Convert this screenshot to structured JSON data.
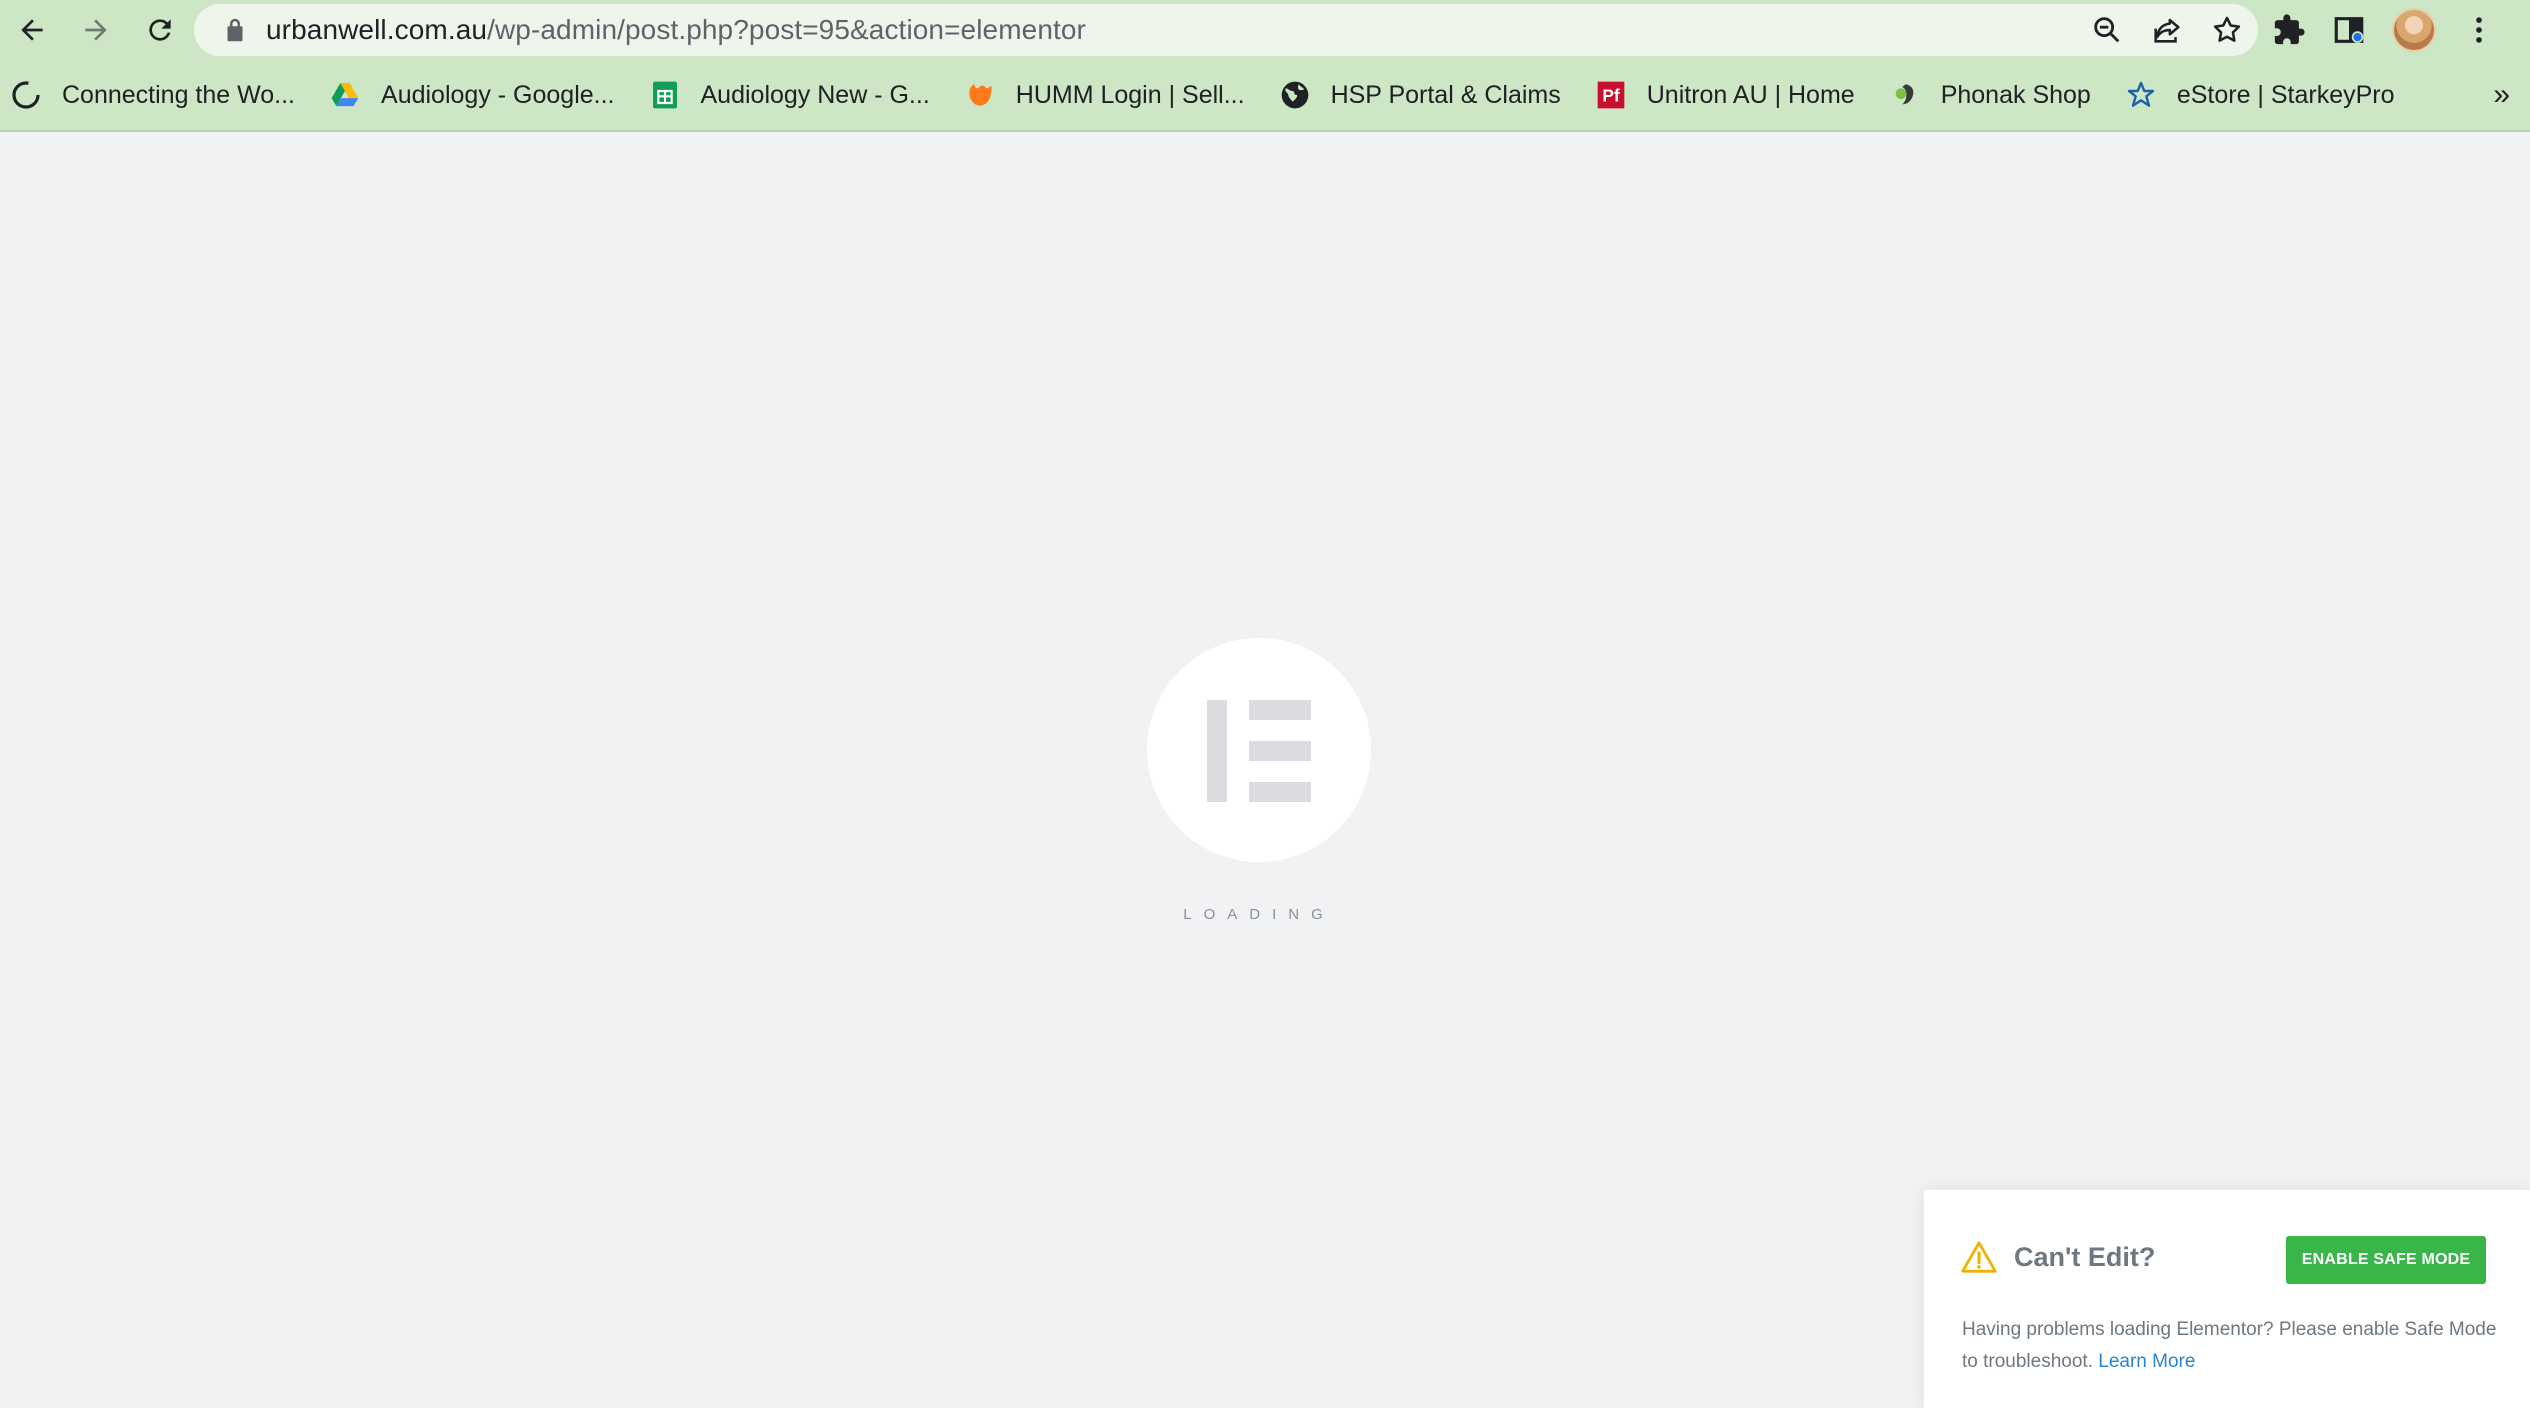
{
  "browser": {
    "url_host": "urbanwell.com.au",
    "url_path": "/wp-admin/post.php?post=95&action=elementor",
    "icons": {
      "back": "back-arrow-icon",
      "forward": "forward-arrow-icon",
      "reload": "reload-icon",
      "lock": "lock-icon",
      "zoom": "zoom-icon",
      "share": "share-icon",
      "bookmark": "star-icon",
      "extensions": "puzzle-icon",
      "sidepanel": "side-panel-icon",
      "menu": "kebab-menu-icon"
    },
    "bookmarks": [
      {
        "label": "Connecting the Wo...",
        "icon": "loading-circle-icon"
      },
      {
        "label": "Audiology - Google...",
        "icon": "google-drive-icon"
      },
      {
        "label": "Audiology New - G...",
        "icon": "google-sheets-icon"
      },
      {
        "label": "HUMM Login | Sell...",
        "icon": "humm-icon"
      },
      {
        "label": "HSP Portal & Claims",
        "icon": "globe-icon"
      },
      {
        "label": "Unitron AU | Home",
        "icon": "unitron-icon"
      },
      {
        "label": "Phonak Shop",
        "icon": "phonak-icon"
      },
      {
        "label": "eStore | StarkeyPro",
        "icon": "starkey-icon"
      }
    ],
    "more_label": "»"
  },
  "page": {
    "loading_text": "LOADING",
    "background": "#f1f2f4"
  },
  "notice": {
    "title": "Can't Edit?",
    "button_label": "ENABLE SAFE MODE",
    "body_text": "Having problems loading Elementor? Please enable Safe Mode to troubleshoot. ",
    "link_text": "Learn More",
    "button_color": "#39b54a",
    "link_color": "#2b84cc",
    "warning_color": "#f0b200"
  }
}
